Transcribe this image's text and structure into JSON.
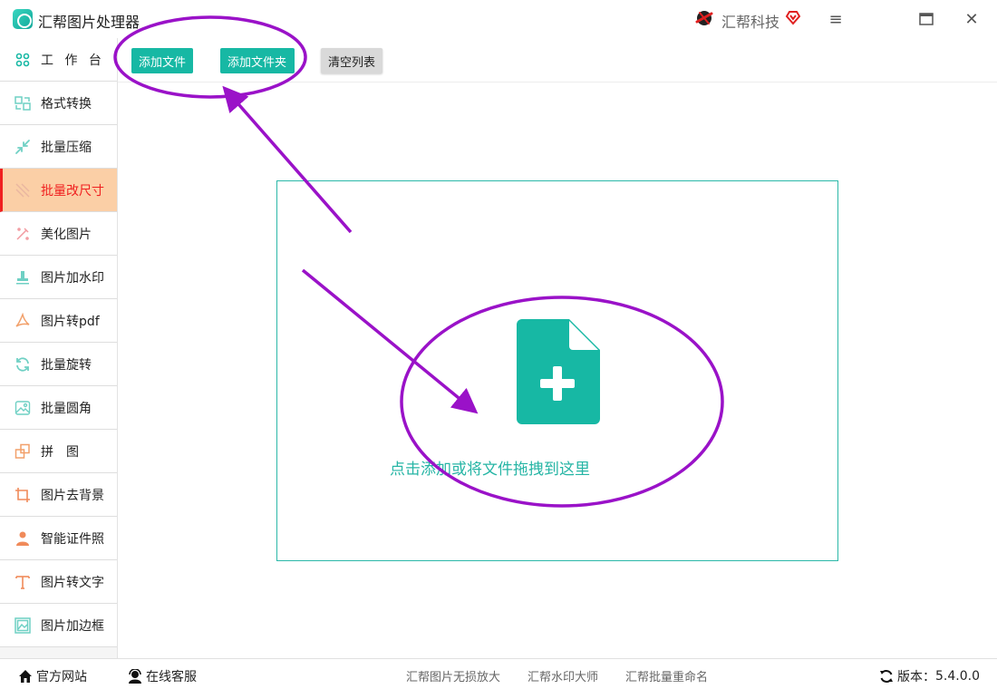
{
  "titlebar": {
    "app_title": "汇帮图片处理器",
    "brand_name": "汇帮科技",
    "menu_icon": "≡",
    "maximize_icon": "▭",
    "close_icon": "✕"
  },
  "sidebar": {
    "items": [
      {
        "label": "工 作 台",
        "icon": "grid-icon"
      },
      {
        "label": "格式转换",
        "icon": "convert-icon"
      },
      {
        "label": "批量压缩",
        "icon": "compress-icon"
      },
      {
        "label": "批量改尺寸",
        "icon": "resize-icon",
        "active": true
      },
      {
        "label": "美化图片",
        "icon": "beautify-icon"
      },
      {
        "label": "图片加水印",
        "icon": "watermark-icon"
      },
      {
        "label": "图片转pdf",
        "icon": "pdf-icon"
      },
      {
        "label": "批量旋转",
        "icon": "rotate-icon"
      },
      {
        "label": "批量圆角",
        "icon": "rounded-corner-icon"
      },
      {
        "label": "拼　图",
        "icon": "collage-icon"
      },
      {
        "label": "图片去背景",
        "icon": "remove-background-icon"
      },
      {
        "label": "智能证件照",
        "icon": "id-photo-icon"
      },
      {
        "label": "图片转文字",
        "icon": "text-icon"
      },
      {
        "label": "图片加边框",
        "icon": "border-icon"
      }
    ]
  },
  "toolbar": {
    "add_file": "添加文件",
    "add_folder": "添加文件夹",
    "clear_list": "清空列表"
  },
  "dropzone": {
    "hint": "点击添加或将文件拖拽到这里"
  },
  "footer": {
    "official_site": "官方网站",
    "online_service": "在线客服",
    "links": [
      "汇帮图片无损放大",
      "汇帮水印大师",
      "汇帮批量重命名"
    ],
    "version_label": "版本：",
    "version_value": "5.4.0.0"
  },
  "colors": {
    "accent": "#17b8a4",
    "active_bg": "#fbcfa6",
    "active_text": "#f02020",
    "annotation": "#9a12c8"
  }
}
